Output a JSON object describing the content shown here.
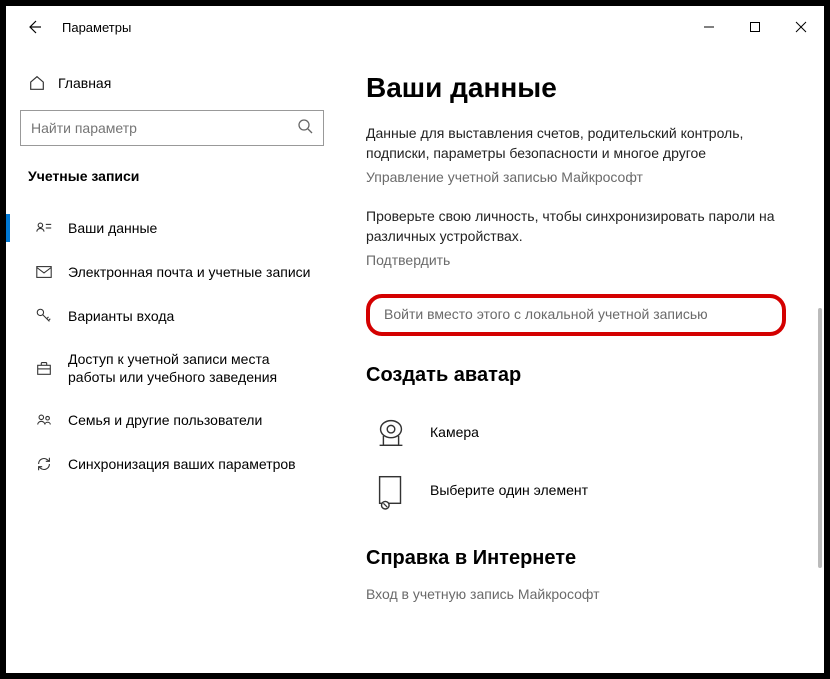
{
  "titlebar": {
    "app_title": "Параметры"
  },
  "sidebar": {
    "home_label": "Главная",
    "search_placeholder": "Найти параметр",
    "section_header": "Учетные записи",
    "items": [
      {
        "label": "Ваши данные"
      },
      {
        "label": "Электронная почта и учетные записи"
      },
      {
        "label": "Варианты входа"
      },
      {
        "label": "Доступ к учетной записи места работы или учебного заведения"
      },
      {
        "label": "Семья и другие пользователи"
      },
      {
        "label": "Синхронизация ваших параметров"
      }
    ]
  },
  "main": {
    "heading": "Ваши данные",
    "billing_text": "Данные для выставления счетов, родительский контроль, подписки, параметры безопасности и многое другое",
    "manage_link": "Управление учетной записью Майкрософт",
    "verify_text": "Проверьте свою личность, чтобы синхронизировать пароли на различных устройствах.",
    "verify_link": "Подтвердить",
    "signin_local_link": "Войти вместо этого с локальной учетной записью",
    "avatar_heading": "Создать аватар",
    "camera_label": "Камера",
    "browse_label": "Выберите один элемент",
    "help_heading": "Справка в Интернете",
    "help_link": "Вход в учетную запись Майкрософт"
  }
}
